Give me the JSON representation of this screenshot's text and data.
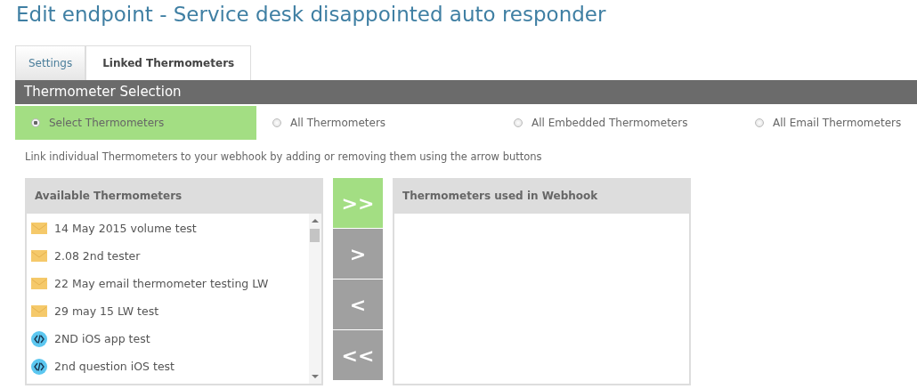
{
  "page_title": "Edit endpoint - Service desk disappointed auto responder",
  "tabs": [
    {
      "label": "Settings",
      "selected": false
    },
    {
      "label": "Linked Thermometers",
      "selected": true
    }
  ],
  "section_title": "Thermometer Selection",
  "options": [
    {
      "label": "Select Thermometers",
      "selected": true
    },
    {
      "label": "All Thermometers",
      "selected": false
    },
    {
      "label": "All Embedded Thermometers",
      "selected": false
    },
    {
      "label": "All Email Thermometers",
      "selected": false
    }
  ],
  "instructions": "Link individual Thermometers to your webhook by adding or removing them using the arrow buttons",
  "available": {
    "title": "Available Thermometers",
    "items": [
      {
        "label": "14 May 2015 volume test",
        "kind": "email"
      },
      {
        "label": "2.08 2nd tester",
        "kind": "email"
      },
      {
        "label": "22 May email thermometer testing LW",
        "kind": "email"
      },
      {
        "label": "29 may 15 LW test",
        "kind": "email"
      },
      {
        "label": "2ND iOS app test",
        "kind": "app"
      },
      {
        "label": "2nd question iOS test",
        "kind": "app"
      }
    ]
  },
  "move_buttons": [
    {
      "label": ">>",
      "active": true
    },
    {
      "label": ">",
      "active": false
    },
    {
      "label": "<",
      "active": false
    },
    {
      "label": "<<",
      "active": false
    }
  ],
  "used": {
    "title": "Thermometers used in Webhook"
  }
}
